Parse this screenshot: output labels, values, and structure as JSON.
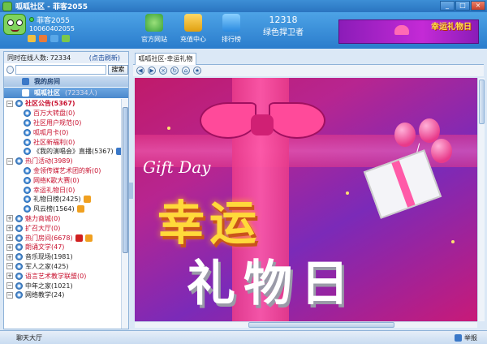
{
  "window": {
    "title": "呱呱社区 - 菲客2055"
  },
  "user": {
    "name": "菲客2055",
    "id": "10060402055"
  },
  "nav": [
    {
      "label": "官方网站",
      "icon": "globe-icon",
      "color": "#4cc14a"
    },
    {
      "label": "充值中心",
      "icon": "coin-icon",
      "color": "#f2b61a"
    },
    {
      "label": "排行榜",
      "icon": "ranking-icon",
      "color": "#4aa3e8"
    }
  ],
  "hotline": {
    "number": "12318",
    "text": "绿色捍卫者"
  },
  "banner": {
    "text": "幸运礼物日"
  },
  "left": {
    "online_label": "同时在线人数:",
    "online_count": "72334",
    "refresh": "(点击刷新)",
    "search_button": "搜索",
    "my_room": "我的房间",
    "community": "呱呱社区",
    "community_count": "(72334人)"
  },
  "tree": [
    {
      "label": "社区公告(5367)",
      "level": 0,
      "bold": true
    },
    {
      "label": "百万大转盘(0)",
      "level": 1
    },
    {
      "label": "社区用户规范(0)",
      "level": 1
    },
    {
      "label": "呱呱月卡(0)",
      "level": 1
    },
    {
      "label": "社区新福利(0)",
      "level": 1
    },
    {
      "label": "《我的演唱会》直播(5367)",
      "level": 1,
      "black": true,
      "badge": "blue"
    },
    {
      "label": "热门活动(3989)",
      "level": 0
    },
    {
      "label": "金领传媒艺术团的新(0)",
      "level": 1
    },
    {
      "label": "网络K歌大赛(0)",
      "level": 1
    },
    {
      "label": "幸运礼物日(0)",
      "level": 1
    },
    {
      "label": "礼物日榜(2425)",
      "level": 1,
      "black": true,
      "badge": "orange"
    },
    {
      "label": "风云榜(1564)",
      "level": 1,
      "black": true,
      "badge": "orange"
    },
    {
      "label": "魅力商城(0)",
      "level": 0,
      "leaf": true
    },
    {
      "label": "扩召大厅(0)",
      "level": 0,
      "leaf": true
    },
    {
      "label": "热门房间(6678)",
      "level": 0,
      "leaf": true,
      "badge": "red2"
    },
    {
      "label": "朗诵文学(47)",
      "level": 0,
      "leaf": true
    },
    {
      "label": "音乐现场(1981)",
      "level": 0,
      "leaf": true,
      "black": true
    },
    {
      "label": "军人之家(425)",
      "level": 0,
      "black": true
    },
    {
      "label": "语言艺术教学联盟(0)",
      "level": 0,
      "leaf": true
    },
    {
      "label": "中年之家(1021)",
      "level": 0,
      "black": true
    },
    {
      "label": "网络教学(24)",
      "level": 0,
      "black": true
    }
  ],
  "tab": {
    "label": "呱呱社区-幸运礼物日"
  },
  "content": {
    "gift_day": "Gift Day",
    "title_line1": "幸运",
    "title_line2": "礼物日"
  },
  "status": {
    "chat": "聊天大厅",
    "report": "举报"
  }
}
